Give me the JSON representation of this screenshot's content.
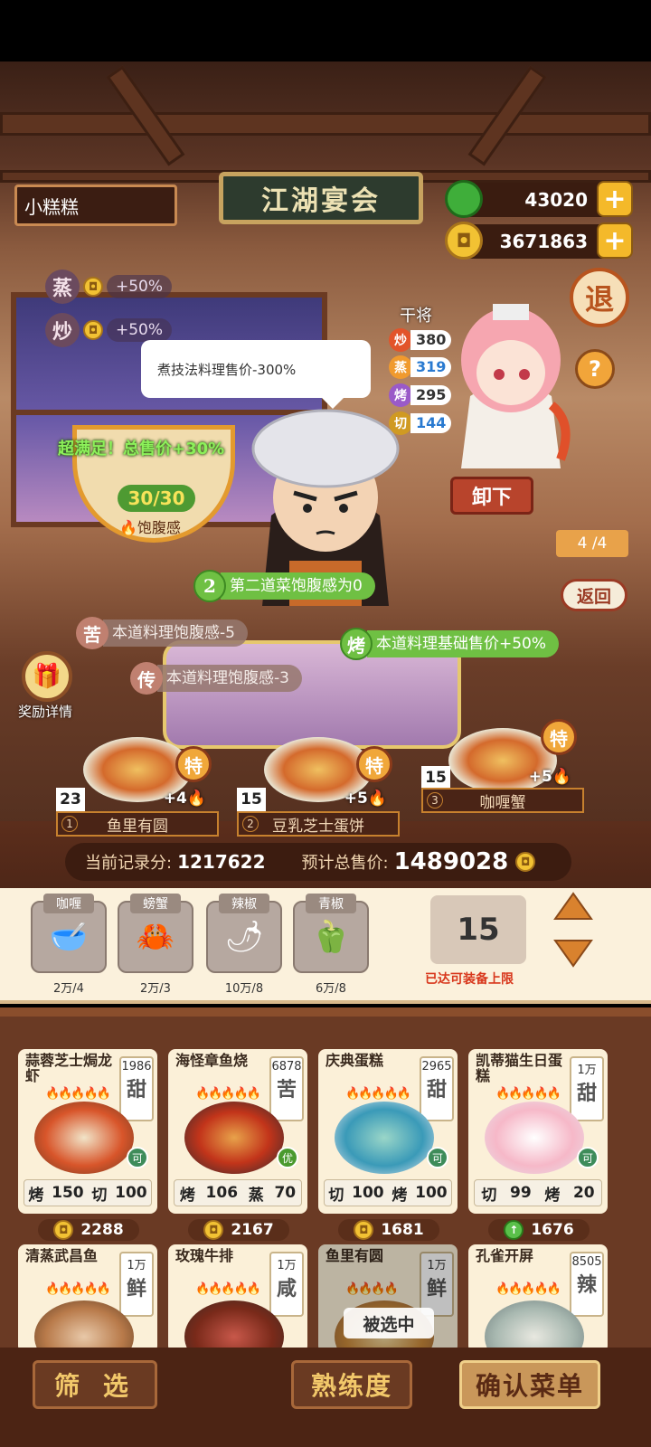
{
  "header": {
    "player_name": "小糕糕",
    "title": "江湖宴会",
    "jade": "43020",
    "gold": "3671863",
    "exit_label": "退",
    "help_label": "?"
  },
  "buffs": [
    {
      "method": "蒸",
      "value": "+50%"
    },
    {
      "method": "炒",
      "value": "+50%"
    }
  ],
  "guest": {
    "speech": "煮技法料理售价-300%",
    "satisfaction_text": "超满足！总售价+30%",
    "fullness": "30/30",
    "fullness_label": "饱腹感"
  },
  "chef": {
    "name": "干将",
    "skills": [
      {
        "label": "炒",
        "value": "380",
        "color": "#e2542a"
      },
      {
        "label": "蒸",
        "value": "319",
        "color": "#f09a2e"
      },
      {
        "label": "烤",
        "value": "295",
        "color": "#9a5ac8"
      },
      {
        "label": "切",
        "value": "144",
        "color": "#d09a22"
      }
    ],
    "unload_label": "卸下"
  },
  "page": {
    "indicator": "4 /4",
    "back_label": "返回"
  },
  "effects": [
    {
      "icon": "2",
      "text": "第二道菜饱腹感为0"
    },
    {
      "icon": "苦",
      "text": "本道料理饱腹感-5"
    },
    {
      "icon": "烤",
      "text": "本道料理基础售价+50%"
    },
    {
      "icon": "传",
      "text": "本道料理饱腹感-3"
    }
  ],
  "reward": {
    "label": "奖励详情"
  },
  "slots": [
    {
      "index": "1",
      "name": "鱼里有圆",
      "count": "23",
      "bonus": "+4",
      "special": "特"
    },
    {
      "index": "2",
      "name": "豆乳芝士蛋饼",
      "count": "15",
      "bonus": "+5",
      "special": "特"
    },
    {
      "index": "3",
      "name": "咖喱蟹",
      "count": "15",
      "bonus": "+5",
      "special": "特"
    }
  ],
  "stats": {
    "record_label": "当前记录分:",
    "record_value": "1217622",
    "total_label": "预计总售价:",
    "total_value": "1489028"
  },
  "ingredients": [
    {
      "name": "咖喱",
      "qty": "2万/4",
      "icon": "🥣"
    },
    {
      "name": "螃蟹",
      "qty": "2万/3",
      "icon": "🦀"
    },
    {
      "name": "辣椒",
      "qty": "10万/8",
      "icon": "🌶"
    },
    {
      "name": "青椒",
      "qty": "6万/8",
      "icon": "🫑"
    }
  ],
  "capacity": {
    "value": "15",
    "note": "已达可装备上限"
  },
  "dishes": [
    {
      "name": "蒜蓉芝士焗龙虾",
      "price": "1986",
      "flavor": "甜",
      "badge": "可",
      "req": [
        "烤",
        "150",
        "切",
        "100"
      ],
      "sell": "2288",
      "flames": "🔥🔥🔥🔥🔥"
    },
    {
      "name": "海怪章鱼烧",
      "price": "6878",
      "flavor": "苦",
      "badge": "优",
      "req": [
        "烤",
        "106",
        "蒸",
        "70"
      ],
      "sell": "2167",
      "flames": "🔥🔥🔥🔥🔥"
    },
    {
      "name": "庆典蛋糕",
      "price": "2965",
      "flavor": "甜",
      "badge": "可",
      "req": [
        "切",
        "100",
        "烤",
        "100"
      ],
      "sell": "1681",
      "flames": "🔥🔥🔥🔥🔥"
    },
    {
      "name": "凯蒂猫生日蛋糕",
      "price": "1万",
      "flavor": "甜",
      "badge": "可",
      "req": [
        "切",
        "99",
        "烤",
        "20"
      ],
      "sell": "1676",
      "flames": "🔥🔥🔥🔥🔥"
    },
    {
      "name": "清蒸武昌鱼",
      "price": "1万",
      "flavor": "鲜",
      "flames": "🔥🔥🔥🔥🔥"
    },
    {
      "name": "玫瑰牛排",
      "price": "1万",
      "flavor": "咸",
      "flames": "🔥🔥🔥🔥🔥"
    },
    {
      "name": "鱼里有圆",
      "price": "1万",
      "flavor": "鲜",
      "flames": "🔥🔥🔥🔥",
      "selected_label": "被选中"
    },
    {
      "name": "孔雀开屏",
      "price": "8505",
      "flavor": "辣",
      "flames": "🔥🔥🔥🔥🔥"
    }
  ],
  "bottom": {
    "filter": "筛 选",
    "mastery": "熟练度",
    "confirm": "确认菜单"
  }
}
